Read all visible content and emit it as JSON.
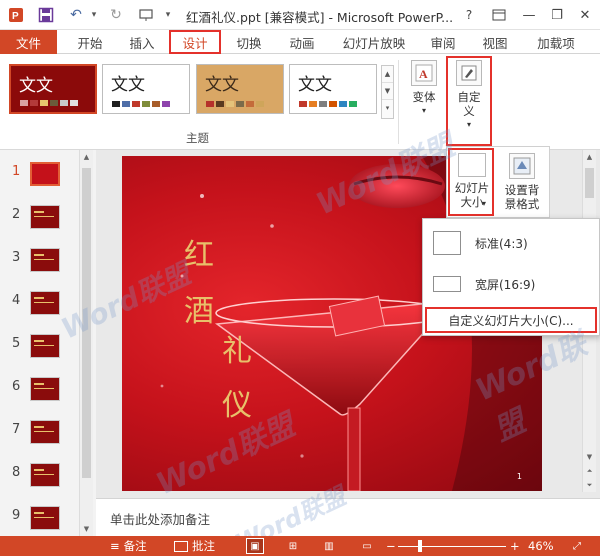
{
  "window": {
    "title": "红酒礼仪.ppt [兼容模式] - Microsoft PowerP...",
    "help_label": "?",
    "minimize_glyph": "—",
    "restore_glyph": "❐",
    "close_glyph": "✕"
  },
  "tabs": {
    "file": "文件",
    "items": [
      "开始",
      "插入",
      "设计",
      "切换",
      "动画",
      "幻灯片放映",
      "审阅",
      "视图",
      "加载项"
    ],
    "active": "设计"
  },
  "ribbon": {
    "themes": [
      {
        "label": "文文",
        "bg": "#8b0a0a",
        "fg": "#ffffff",
        "dots": [
          "#d9a3a3",
          "#b33a3a",
          "#e7c66d",
          "#6b5b3a",
          "#c9c9c9",
          "#e1e1e1"
        ]
      },
      {
        "label": "文文",
        "bg": "#ffffff",
        "fg": "#222222",
        "dots": [
          "#1f1f1f",
          "#4f6ea8",
          "#c0392b",
          "#7f8c3a",
          "#a85d2a",
          "#8e44ad"
        ]
      },
      {
        "label": "文文",
        "bg": "#d9a765",
        "fg": "#3b2a1a",
        "dots": [
          "#b5312b",
          "#5a3a1f",
          "#e5c37a",
          "#7b6b4a",
          "#c46b3a",
          "#cfa55a"
        ]
      },
      {
        "label": "文文",
        "bg": "#ffffff",
        "fg": "#222222",
        "dots": [
          "#c0392b",
          "#e67e22",
          "#7f7f7f",
          "#d35400",
          "#2e86c1",
          "#27ae60"
        ]
      }
    ],
    "theme_group_label": "主题",
    "variant_label": "变体",
    "customize_label": "自定义",
    "slide_size_label": "幻灯片大小",
    "background_label": "设置背景格式"
  },
  "slide_size_menu": {
    "standard": "标准(4:3)",
    "widescreen": "宽屏(16:9)",
    "custom": "自定义幻灯片大小(C)..."
  },
  "thumbnails": [
    "1",
    "2",
    "3",
    "4",
    "5",
    "6",
    "7",
    "8",
    "9"
  ],
  "active_slide": "1",
  "slide": {
    "title_chars": [
      "红",
      "酒",
      "礼",
      "仪"
    ],
    "page_number": "1"
  },
  "notes": {
    "placeholder": "单击此处添加备注"
  },
  "statusbar": {
    "notes_label": "备注",
    "comments_label": "批注",
    "zoom_minus": "−",
    "zoom_plus": "+",
    "zoom_level": "46%"
  },
  "watermark": "Word联盟",
  "colors": {
    "accent": "#d24726",
    "highlight": "#e4312b",
    "slide_red": "#c5121b",
    "title_gold": "#e8c06a"
  }
}
